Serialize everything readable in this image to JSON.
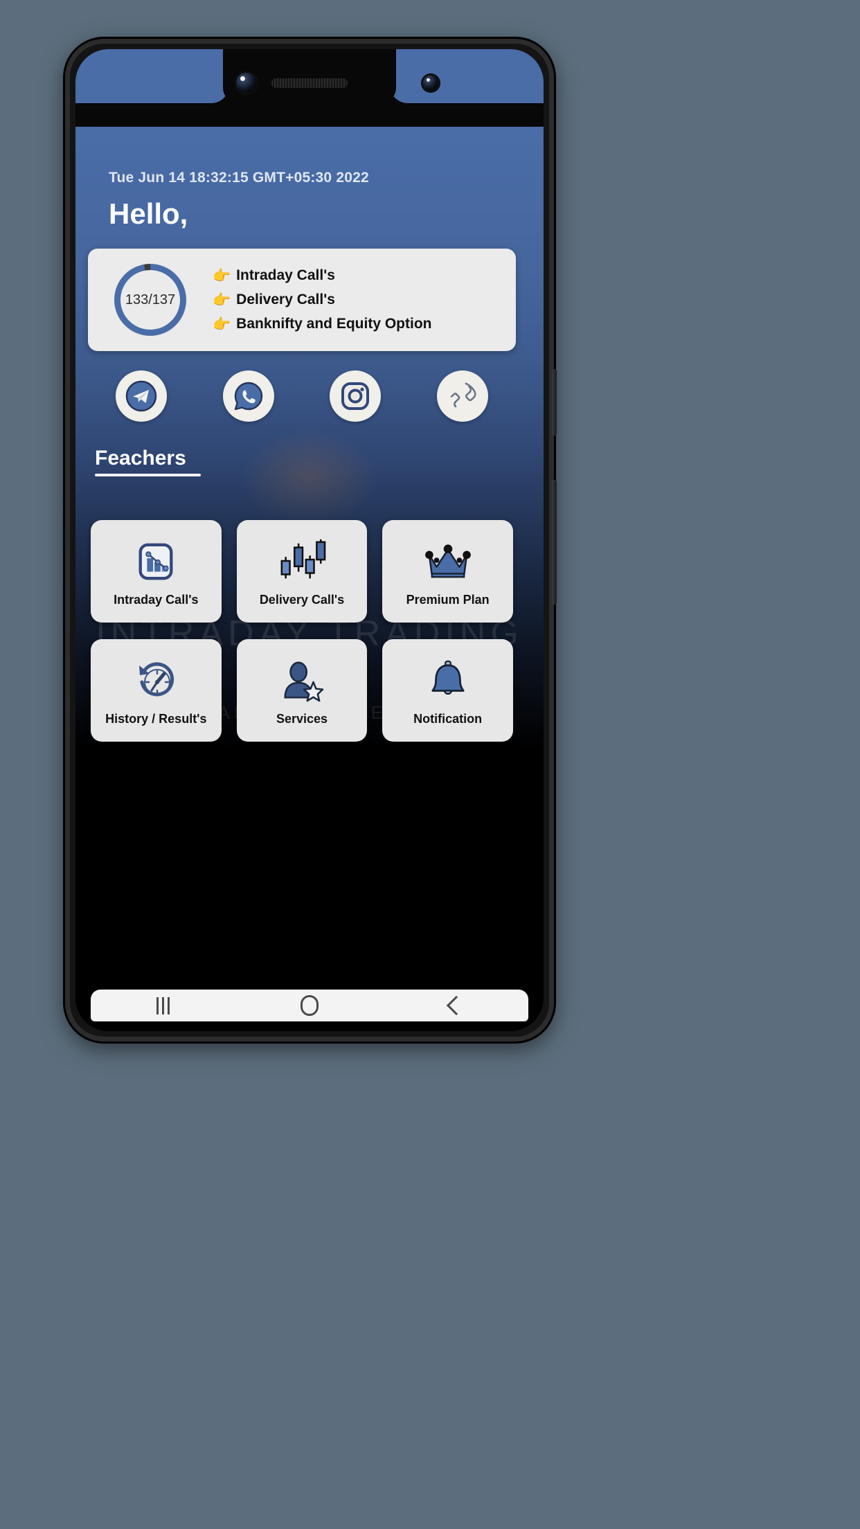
{
  "device": {
    "notch": {
      "camera_primary": "camera-lens-icon",
      "camera_secondary": "camera-lens-icon",
      "earpiece": "speaker-grille-icon"
    }
  },
  "app": {
    "datetime": "Tue Jun 14 18:32:15 GMT+05:30 2022",
    "greeting": "Hello,",
    "watermark": {
      "line1": "INTRADAY TRADING TIPS",
      "line2": "MARKET LEADERS"
    },
    "info_card": {
      "progress_label": "133/137",
      "progress_current": 133,
      "progress_total": 137,
      "bullets": [
        {
          "point": "👉",
          "text": "Intraday Call's"
        },
        {
          "point": "👉",
          "text": "Delivery Call's"
        },
        {
          "point": "👉",
          "text": "Banknifty and Equity Option"
        }
      ]
    },
    "socials": [
      {
        "name": "telegram",
        "icon": "telegram-icon"
      },
      {
        "name": "whatsapp",
        "icon": "whatsapp-icon"
      },
      {
        "name": "instagram",
        "icon": "instagram-icon"
      },
      {
        "name": "call",
        "icon": "phone-icon"
      }
    ],
    "section": {
      "title": "Feachers"
    },
    "features": [
      {
        "label": "Intraday Call's",
        "icon": "bar-chart-icon"
      },
      {
        "label": "Delivery Call's",
        "icon": "candlestick-chart-icon"
      },
      {
        "label": "Premium Plan",
        "icon": "crown-icon"
      },
      {
        "label": "History / Result's",
        "icon": "clock-history-icon"
      },
      {
        "label": "Services",
        "icon": "user-star-icon"
      },
      {
        "label": "Notification",
        "icon": "bell-icon"
      }
    ],
    "navbar": [
      {
        "name": "recents",
        "icon": "recents-icon"
      },
      {
        "name": "home",
        "icon": "home-icon"
      },
      {
        "name": "back",
        "icon": "back-icon"
      }
    ]
  },
  "colors": {
    "accent_blue": "#4a6da8",
    "card_bg": "#ebebeb",
    "tile_bg": "#e7e7e7",
    "header_blue": "#4a6da8"
  }
}
